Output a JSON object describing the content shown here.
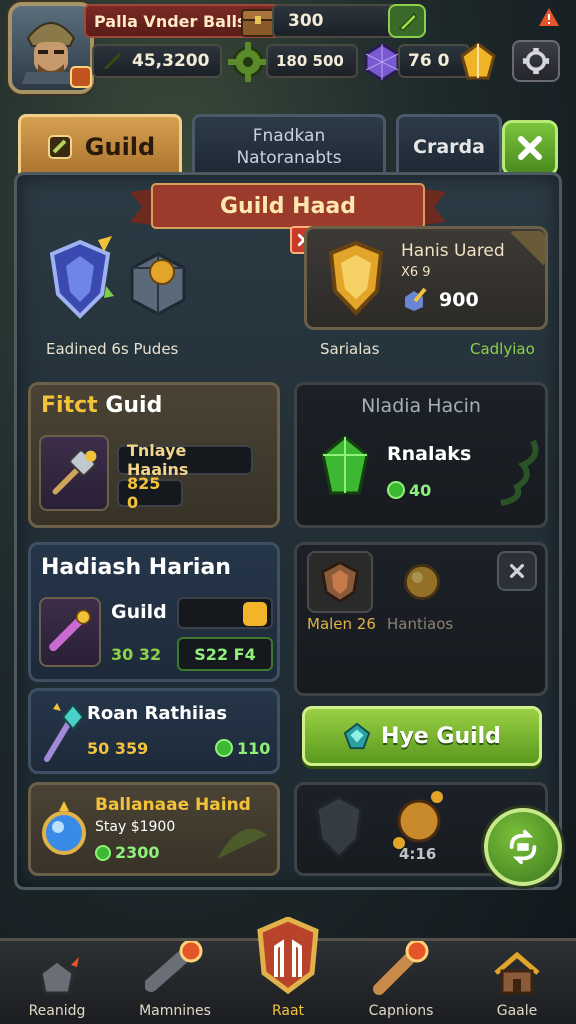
{
  "player": {
    "name": "Palla Vnder Balls",
    "stat_main": "45,3200",
    "currency_gold": "300",
    "currency_green": "180 500",
    "currency_purple": "76 0"
  },
  "tabs": {
    "guild_label": "Guild",
    "middle_line1": "Fnadkan",
    "middle_line2": "Natoranabts",
    "right_label": "Crarda"
  },
  "banner": {
    "title": "Guild Haad"
  },
  "top_section": {
    "left_caption": "Eadined 6s Pudes",
    "mid_caption": "Sarialas",
    "right_caption": "Cadlyiao",
    "reward_title": "Hanis Uared",
    "reward_sub": "X6 9",
    "reward_value": "900"
  },
  "card_fitct": {
    "title_accent": "Fitct",
    "title_rest": "Guid",
    "name": "Tnlaye Haains",
    "value": "825 0"
  },
  "card_madia": {
    "title": "Nladia Hacin",
    "name": "Rnalaks",
    "value": "40"
  },
  "card_hadiash": {
    "title": "Hadiash Harian",
    "name": "Guild",
    "value_left": "30 32",
    "value_right": "S22 F4"
  },
  "card_slots": {
    "slot1_label": "Malen 26",
    "slot2_label": "Hantiaos"
  },
  "card_roan": {
    "title": "Roan Rathiias",
    "value_left": "50 359",
    "value_right": "110"
  },
  "hire_button": {
    "label": "Hye Guild"
  },
  "card_balance": {
    "title": "Ballanaae Haind",
    "line2": "Stay $1900",
    "value": "2300"
  },
  "card_locked": {
    "value": "4:16"
  },
  "bottom_nav": [
    {
      "label": "Reanidg"
    },
    {
      "label": "Mamnines"
    },
    {
      "label": "Raat"
    },
    {
      "label": "Capnions"
    },
    {
      "label": "Gaale"
    }
  ],
  "colors": {
    "gold": "#e9b53a",
    "green": "#6fae2c",
    "red_banner": "#9b3b2b",
    "panel": "#233038"
  }
}
